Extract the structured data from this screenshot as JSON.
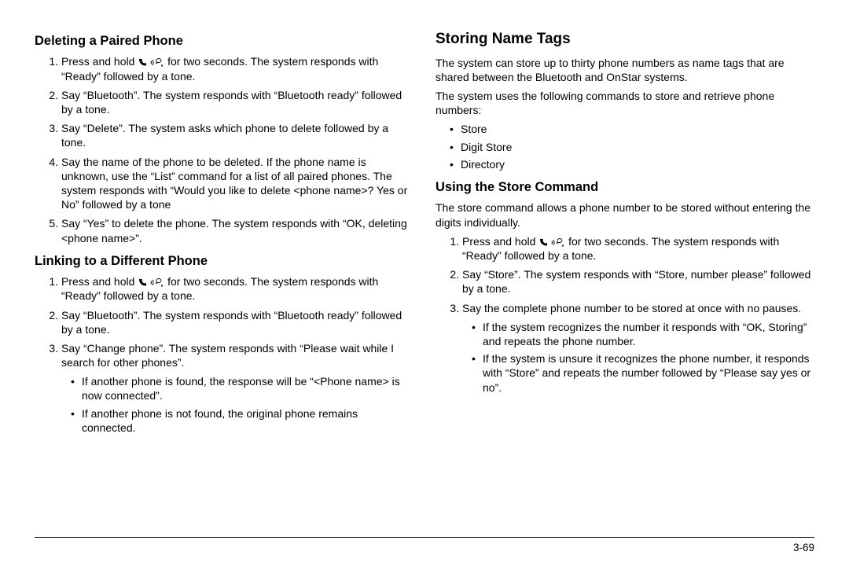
{
  "left": {
    "h_delete": "Deleting a Paired Phone",
    "delete_steps": [
      "Press and hold {icon} for two seconds. The system responds with “Ready” followed by a tone.",
      "Say “Bluetooth”. The system responds with “Bluetooth ready” followed by a tone.",
      "Say “Delete”. The system asks which phone to delete followed by a tone.",
      "Say the name of the phone to be deleted. If the phone name is unknown, use the “List” command for a list of all paired phones. The system responds with “Would you like to delete <phone name>? Yes or No” followed by a tone",
      "Say “Yes” to delete the phone. The system responds with “OK, deleting <phone name>”."
    ],
    "h_link": "Linking to a Different Phone",
    "link_steps": [
      "Press and hold {icon} for two seconds. The system responds with “Ready” followed by a tone.",
      "Say “Bluetooth”. The system responds with “Bluetooth ready” followed by a tone.",
      "Say “Change phone”. The system responds with “Please wait while I search for other phones”."
    ],
    "link_sub": [
      "If another phone is found, the response will be “<Phone name> is now connected”.",
      "If another phone is not found, the original phone remains connected."
    ]
  },
  "right": {
    "h_storing": "Storing Name Tags",
    "storing_p1": "The system can store up to thirty phone numbers as name tags that are shared between the Bluetooth and OnStar systems.",
    "storing_p2": "The system uses the following commands to store and retrieve phone numbers:",
    "storing_cmds": [
      "Store",
      "Digit Store",
      "Directory"
    ],
    "h_using": "Using the Store Command",
    "using_p1": "The store command allows a phone number to be stored without entering the digits individually.",
    "using_steps": [
      "Press and hold {icon} for two seconds. The system responds with “Ready” followed by a tone.",
      "Say “Store”. The system responds with “Store, number please” followed by a tone.",
      "Say the complete phone number to be stored at once with no pauses."
    ],
    "using_sub": [
      "If the system recognizes the number it responds with “OK, Storing” and repeats the phone number.",
      "If the system is unsure it recognizes the phone number, it responds with “Store” and repeats the number followed by “Please say yes or no”."
    ]
  },
  "page_num": "3-69"
}
